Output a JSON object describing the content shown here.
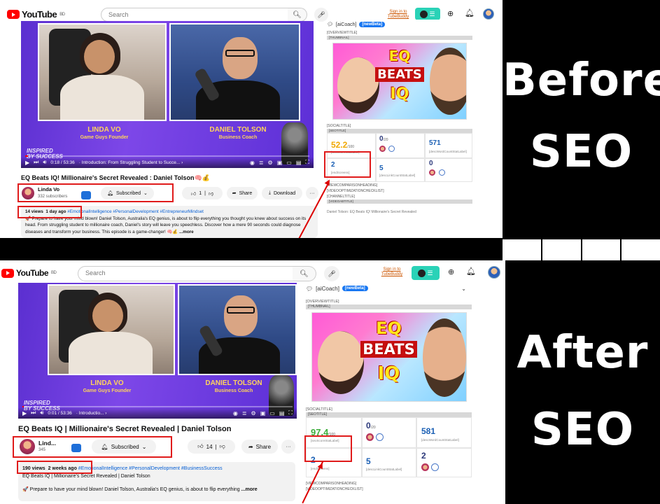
{
  "labels": {
    "before_line1": "Before",
    "before_line2": "SEO",
    "after_line1": "After",
    "after_line2": "SEO"
  },
  "header": {
    "logo_text": "YouTube",
    "logo_region": "BD",
    "search_placeholder": "Search",
    "sign_in": "Sign in to\nTubeBuddy"
  },
  "before": {
    "video": {
      "host_left_name": "LINDA VO",
      "host_left_title": "Game Guys Founder",
      "host_right_name": "DANIEL TOLSON",
      "host_right_title": "Business Coach",
      "watermark": "INSPIRED\nBY SUCCESS",
      "time": "0:18 / 53:36",
      "chapter": "· Introduction: From Struggling Student to Succe... ›",
      "progress": 0.01
    },
    "title": "EQ Beats IQ! Millionaire's Secret Revealed : Daniel Tolson🧠💰",
    "channel_name": "Linda Vo",
    "channel_subs": "332 subscribers",
    "subscribed": "Subscribed",
    "likes": "1",
    "share": "Share",
    "download": "Download",
    "more": "···",
    "desc_views": "14 views",
    "desc_when": "1 day ago",
    "desc_tags": "#EmotionalIntelligence #PersonalDevelopment #EntrepreneurMindset",
    "desc_body": "🚀 Prepare to have your mind blown! Daniel Tolson, Australia's EQ genius, is about to flip everything you thought you knew about success on its head. From struggling student to millionaire coach, Daniel's story will leave you speechless. Discover how a mere 90 seconds could diagnose diseases and transform your business. This episode is a game-changer! 🧠💰",
    "desc_more": "...more",
    "panel": {
      "ai_coach": "[aiCoach]",
      "new_beta": "[newBeta]",
      "overview_title": "[OVERVIEWTITLE]",
      "thumbnail": "[THUMBNAIL]",
      "social_title": "[SOCIALTITLE]",
      "seo_title": "[SEOTITLE]",
      "seo_score": "52.2",
      "seo_score_max": "/100",
      "seo_score_label": "[seoScoreStatLabel]",
      "cell2_num": "0",
      "cell2_max": "/20",
      "word_count": "571",
      "word_count_label": "[descWordCountStatLabel]",
      "cell4_num": "2",
      "cell4_label": "[endScreens]",
      "link_count": "5",
      "link_count_label": "[descLinkCountStatLabel]",
      "cell6_num": "0",
      "view_comparison": "[VIEWCOMPARISONHEADING]",
      "video_checklist": "[VIDEOOPTIMIZATIONCHECKLIST]",
      "channel_title": "[CHANNELTITLE]",
      "video_ab": "[VIDEOABTITLE]",
      "footer_title": "Daniel Tolson: EQ Beats IQ! Millionaire's Secret Revealed"
    },
    "thumb_words": [
      "EQ",
      "BEATS",
      "IQ"
    ]
  },
  "after": {
    "video": {
      "host_left_name": "LINDA VO",
      "host_left_title": "Game Guys Founder",
      "host_right_name": "DANIEL TOLSON",
      "host_right_title": "Business Coach",
      "watermark": "INSPIRED\nBY SUCCESS",
      "time": "0:01 / 53:36",
      "chapter": "· Introductio... ›",
      "progress": 0.0
    },
    "title": "EQ Beats IQ | Millionaire's Secret Revealed | Daniel Tolson",
    "channel_name": "Lind...",
    "channel_subs": "345",
    "subscribed": "Subscribed",
    "likes": "14",
    "share": "Share",
    "more": "···",
    "desc_views": "190 views",
    "desc_when": "2 weeks ago",
    "desc_tags": "#EmotionalIntelligence #PersonalDevelopment #BusinessSuccess",
    "desc_line2": "EQ Beats IQ | Millionaire's Secret Revealed | Daniel Tolson",
    "desc_body": "🚀 Prepare to have your mind blown! Daniel Tolson, Australia's EQ genius, is about to flip everything",
    "desc_more": "...more",
    "panel": {
      "ai_coach": "[aiCoach]",
      "new_beta": "[newBeta]",
      "overview_title": "[OVERVIEWTITLE]",
      "thumbnail": "[THUMBNAIL]",
      "social_title": "[SOCIALTITLE]",
      "seo_title": "[SEOTITLE]",
      "seo_score": "97.4",
      "seo_score_max": "/100",
      "seo_score_label": "[seoScoreStatLabel]",
      "cell2_num": "0",
      "cell2_max": "/20",
      "word_count": "581",
      "word_count_label": "[descWordCountStatLabel]",
      "cell4_num": "2",
      "cell4_label": "[endScreens]",
      "link_count": "5",
      "link_count_label": "[descLinkCountStatLabel]",
      "cell6_num": "2",
      "view_comparison": "[VIEWCOMPARISONHEADING]",
      "video_checklist": "[VIDEOOPTIMIZATIONCHECKLIST]"
    },
    "thumb_words": [
      "EQ",
      "BEATS",
      "IQ"
    ]
  },
  "colors": {
    "yt_red": "#ff0000",
    "highlight_red": "#e01b1b",
    "tubebuddy_teal": "#2ad2b7",
    "score_before": "#f0a800",
    "score_after": "#3cae3c"
  }
}
